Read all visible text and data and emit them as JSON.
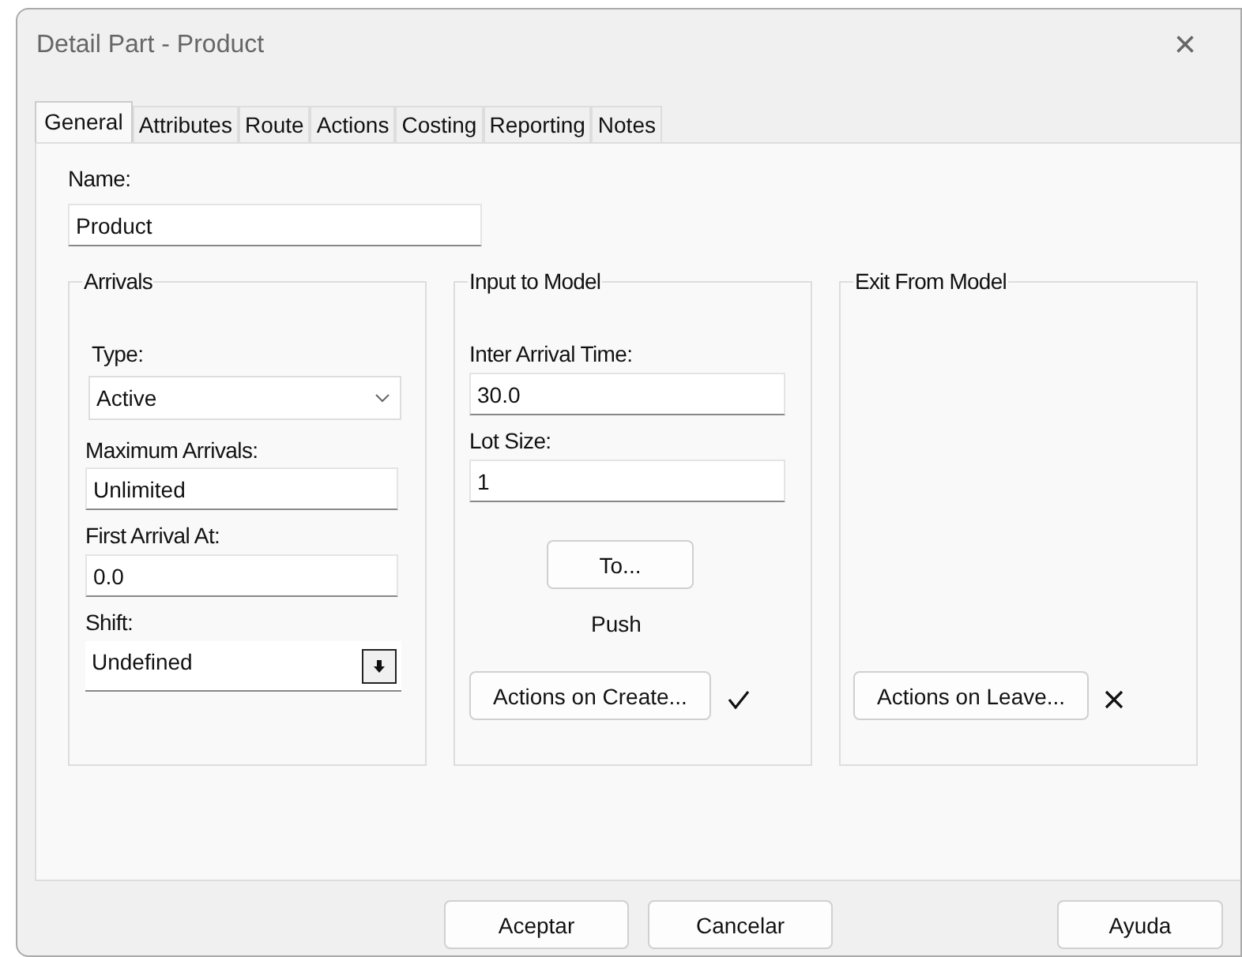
{
  "window": {
    "title": "Detail Part - Product",
    "close": "×"
  },
  "tabs": [
    {
      "label": "General",
      "selected": true
    },
    {
      "label": "Attributes",
      "selected": false
    },
    {
      "label": "Route",
      "selected": false
    },
    {
      "label": "Actions",
      "selected": false
    },
    {
      "label": "Costing",
      "selected": false
    },
    {
      "label": "Reporting",
      "selected": false
    },
    {
      "label": "Notes",
      "selected": false
    }
  ],
  "name": {
    "label": "Name:",
    "value": "Product"
  },
  "arrivals": {
    "title": "Arrivals",
    "type_label": "Type:",
    "type_value": "Active",
    "max_label": "Maximum Arrivals:",
    "max_value": "Unlimited",
    "first_label": "First Arrival At:",
    "first_value": "0.0",
    "shift_label": "Shift:",
    "shift_value": "Undefined"
  },
  "input": {
    "title": "Input to Model",
    "iat_label": "Inter Arrival Time:",
    "iat_value": "30.0",
    "lot_label": "Lot Size:",
    "lot_value": "1",
    "to_button": "To...",
    "routing": "Push",
    "actions_button": "Actions on Create...",
    "actions_defined": true
  },
  "exit": {
    "title": "Exit From Model",
    "actions_button": "Actions on Leave...",
    "actions_defined": false
  },
  "buttons": [
    {
      "label": "Aceptar",
      "kind": "main"
    },
    {
      "label": "Cancelar",
      "kind": "main"
    },
    {
      "label": "Ayuda",
      "kind": "help"
    }
  ]
}
